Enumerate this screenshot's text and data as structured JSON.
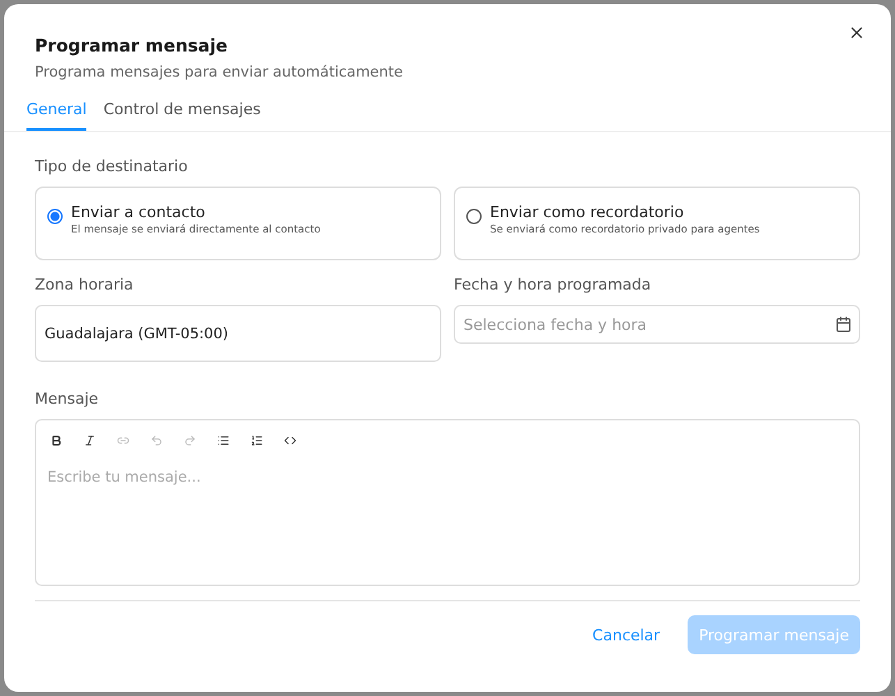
{
  "dialog": {
    "title": "Programar mensaje",
    "subtitle": "Programa mensajes para enviar automáticamente"
  },
  "tabs": [
    {
      "label": "General",
      "selected": true
    },
    {
      "label": "Control de mensajes",
      "selected": false
    }
  ],
  "recipient": {
    "label": "Tipo de destinatario",
    "options": [
      {
        "title": "Enviar a contacto",
        "description": "El mensaje se enviará directamente al contacto",
        "selected": true
      },
      {
        "title": "Enviar como recordatorio",
        "description": "Se enviará como recordatorio privado para agentes",
        "selected": false
      }
    ]
  },
  "timezone": {
    "label": "Zona horaria",
    "value": "Guadalajara (GMT-05:00)"
  },
  "datetime": {
    "label": "Fecha y hora programada",
    "placeholder": "Selecciona fecha y hora"
  },
  "message": {
    "label": "Mensaje",
    "placeholder": "Escribe tu mensaje...",
    "toolbar": [
      {
        "kind": "bold",
        "disabled": false
      },
      {
        "kind": "italic",
        "disabled": false
      },
      {
        "kind": "link",
        "disabled": true
      },
      {
        "kind": "undo",
        "disabled": true
      },
      {
        "kind": "redo",
        "disabled": true
      },
      {
        "kind": "bullets",
        "disabled": false
      },
      {
        "kind": "numbers",
        "disabled": false
      },
      {
        "kind": "code",
        "disabled": false
      }
    ]
  },
  "footer": {
    "cancel": "Cancelar",
    "submit": {
      "label": "Programar mensaje",
      "disabled": true
    }
  }
}
